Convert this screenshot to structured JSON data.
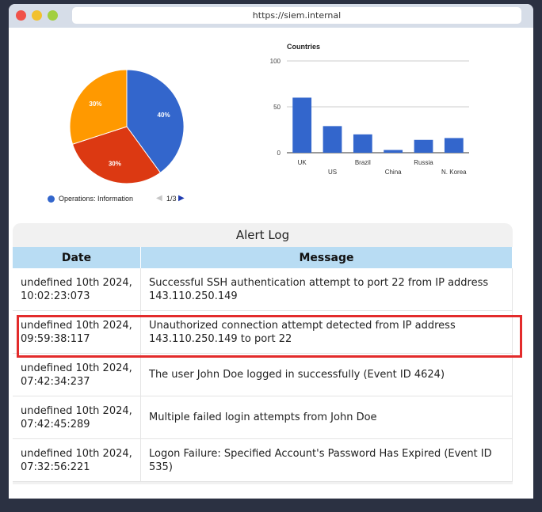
{
  "browser": {
    "url": "https://siem.internal"
  },
  "pie_chart": {
    "slice_labels": [
      "40%",
      "30%",
      "30%"
    ],
    "colors": [
      "#3366cc",
      "#dc3912",
      "#ff9900"
    ],
    "legend_label": "Operations: Information",
    "legend_page": "1/3"
  },
  "chart_data": {
    "type": "bar",
    "title": "Countries",
    "categories": [
      "UK",
      "US",
      "Brazil",
      "China",
      "Russia",
      "N. Korea"
    ],
    "values": [
      60,
      29,
      20,
      3,
      14,
      16
    ],
    "ylim": [
      0,
      100
    ],
    "yticks": [
      "0",
      "50",
      "100"
    ],
    "color": "#3366cc"
  },
  "alert_log": {
    "title": "Alert Log",
    "columns": [
      "Date",
      "Message"
    ],
    "rows": [
      {
        "date": "undefined 10th 2024, 10:02:23:073",
        "message": "Successful SSH authentication attempt to port 22 from IP address 143.110.250.149"
      },
      {
        "date": "undefined 10th 2024, 09:59:38:117",
        "message": "Unauthorized connection attempt detected from IP address 143.110.250.149 to port 22"
      },
      {
        "date": "undefined 10th 2024, 07:42:34:237",
        "message": "The user John Doe logged in successfully (Event ID 4624)"
      },
      {
        "date": "undefined 10th 2024, 07:42:45:289",
        "message": "Multiple failed login attempts from John Doe"
      },
      {
        "date": "undefined 10th 2024, 07:32:56:221",
        "message": "Logon Failure: Specified Account's Password Has Expired (Event ID 535)"
      }
    ],
    "highlight_color": "#e32b2b"
  }
}
